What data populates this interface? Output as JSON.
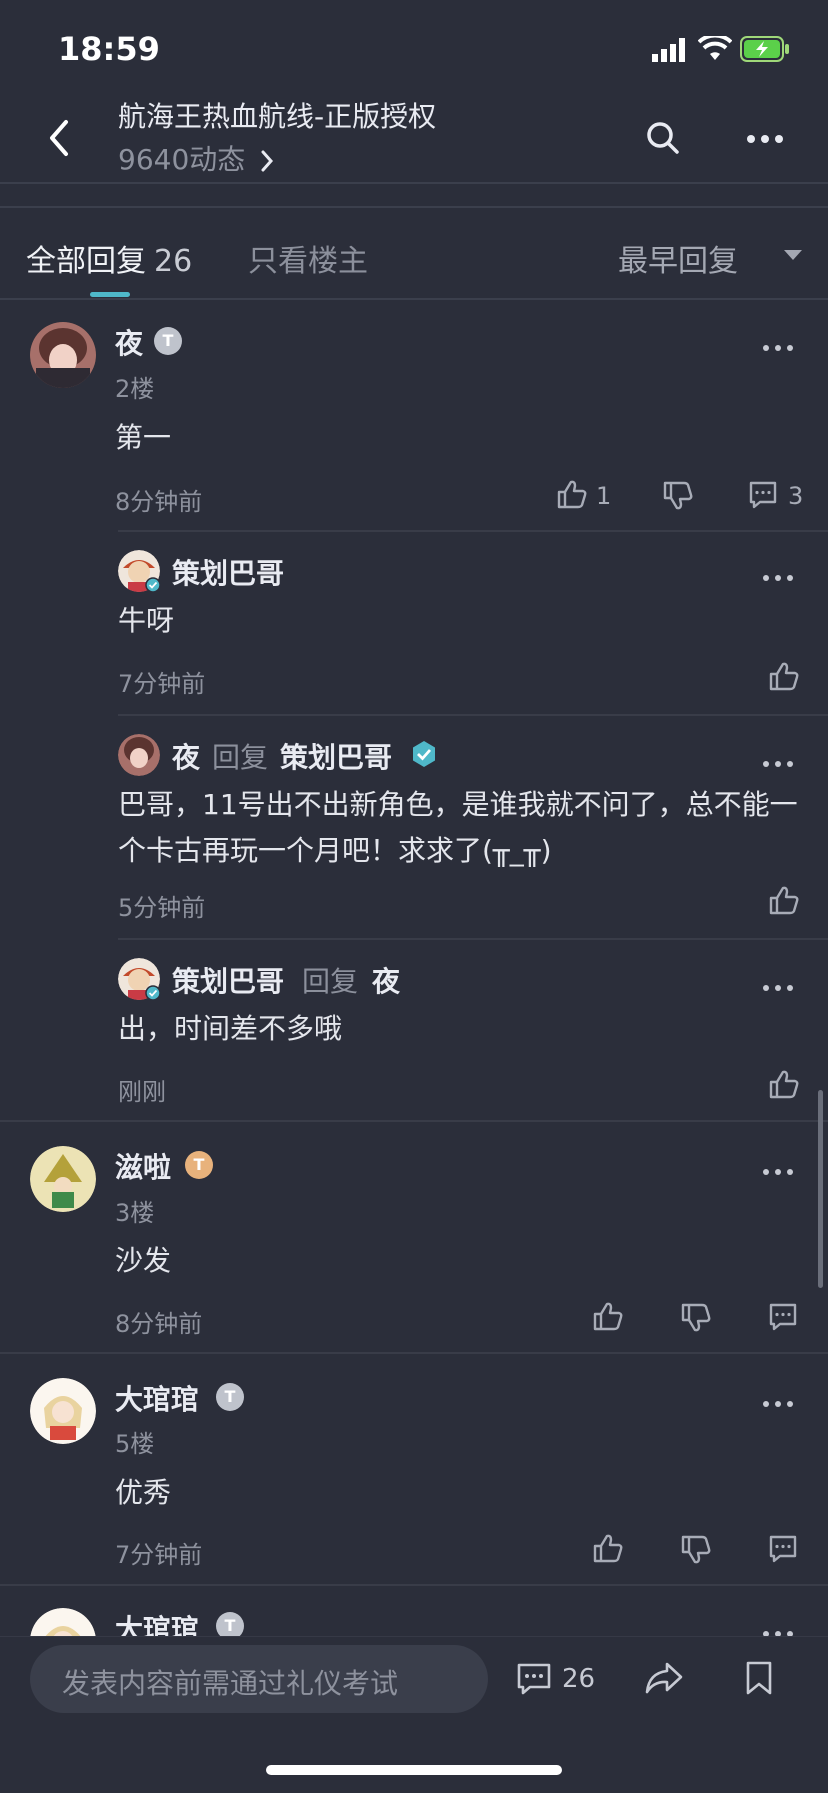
{
  "status": {
    "time": "18:59"
  },
  "header": {
    "title": "航海王热血航线-正版授权",
    "subtitle": "9640动态"
  },
  "tabs": {
    "all_label": "全部回复",
    "all_count": "26",
    "op_only": "只看楼主",
    "sort": "最早回复"
  },
  "comments": [
    {
      "name": "夜",
      "floor": "2楼",
      "text": "第一",
      "time": "8分钟前",
      "likes": "1",
      "replies_count": "3",
      "replies": [
        {
          "name": "策划巴哥",
          "text": "牛呀",
          "time": "7分钟前"
        },
        {
          "name": "夜",
          "reply_word": "回复",
          "target": "策划巴哥",
          "text": "巴哥，11号出不出新角色，是谁我就不问了，总不能一个卡古再玩一个月吧！求求了(╥_╥)",
          "time": "5分钟前"
        },
        {
          "name": "策划巴哥",
          "reply_word": "回复",
          "target": "夜",
          "text": "出，时间差不多哦",
          "time": "刚刚"
        }
      ]
    },
    {
      "name": "滋啦",
      "floor": "3楼",
      "text": "沙发",
      "time": "8分钟前"
    },
    {
      "name": "大琯琯",
      "floor": "5楼",
      "text": "优秀",
      "time": "7分钟前"
    },
    {
      "name": "大琯琯"
    }
  ],
  "badge_letter": "T",
  "bottom": {
    "placeholder": "发表内容前需通过礼仪考试",
    "comment_count": "26"
  },
  "colors": {
    "background": "#2b2e3a",
    "accent": "#4fb8c9",
    "badge_silver": "#bfc3cc",
    "badge_gold": "#e8b27c",
    "verified": "#4fb8c9"
  }
}
